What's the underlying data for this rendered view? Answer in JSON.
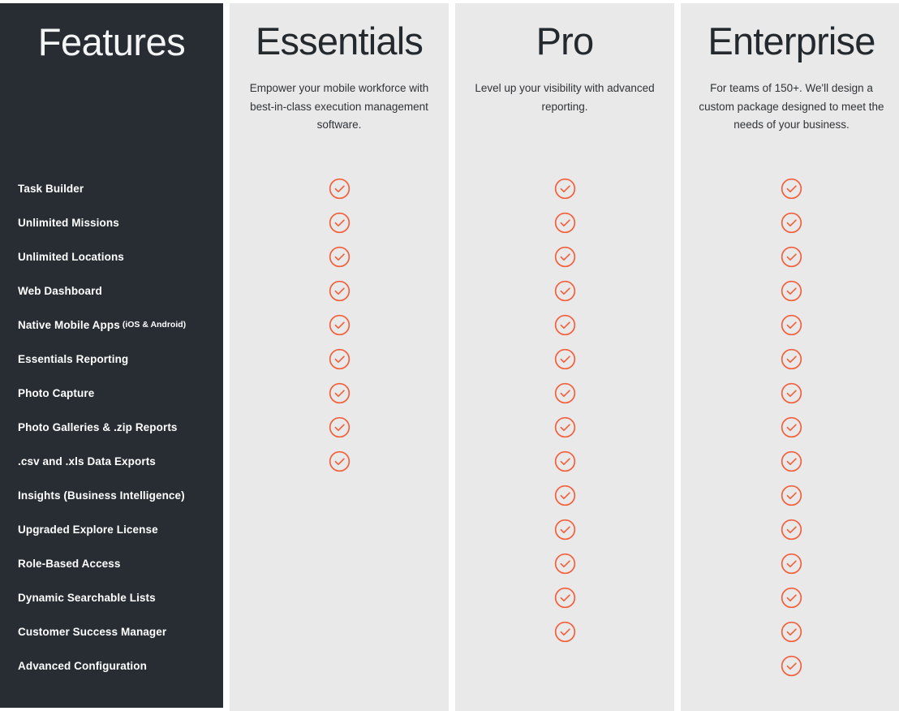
{
  "accent_color": "#f2603c",
  "sidebar_bg": "#272d33",
  "plan_bg": "#e9e9e9",
  "features": {
    "title": "Features",
    "items": [
      {
        "label": "Task Builder",
        "sub": ""
      },
      {
        "label": "Unlimited Missions",
        "sub": ""
      },
      {
        "label": "Unlimited Locations",
        "sub": ""
      },
      {
        "label": "Web Dashboard",
        "sub": ""
      },
      {
        "label": "Native Mobile Apps",
        "sub": "(iOS & Android)"
      },
      {
        "label": "Essentials Reporting",
        "sub": ""
      },
      {
        "label": "Photo Capture",
        "sub": ""
      },
      {
        "label": "Photo Galleries & .zip Reports",
        "sub": ""
      },
      {
        "label": ".csv and .xls Data Exports",
        "sub": ""
      },
      {
        "label": "Insights (Business Intelligence)",
        "sub": ""
      },
      {
        "label": "Upgraded Explore License",
        "sub": ""
      },
      {
        "label": "Role-Based Access",
        "sub": ""
      },
      {
        "label": "Dynamic Searchable Lists",
        "sub": ""
      },
      {
        "label": "Customer Success Manager",
        "sub": ""
      },
      {
        "label": "Advanced Configuration",
        "sub": ""
      }
    ]
  },
  "plans": [
    {
      "name": "Essentials",
      "description": "Empower your mobile workforce with best-in-class execution management software.",
      "included": [
        true,
        true,
        true,
        true,
        true,
        true,
        true,
        true,
        true,
        false,
        false,
        false,
        false,
        false,
        false
      ]
    },
    {
      "name": "Pro",
      "description": "Level up your visibility with advanced reporting.",
      "included": [
        true,
        true,
        true,
        true,
        true,
        true,
        true,
        true,
        true,
        true,
        true,
        true,
        true,
        true,
        false
      ]
    },
    {
      "name": "Enterprise",
      "description": "For teams of 150+. We'll design a custom package designed to meet the needs of your business.",
      "included": [
        true,
        true,
        true,
        true,
        true,
        true,
        true,
        true,
        true,
        true,
        true,
        true,
        true,
        true,
        true
      ]
    }
  ],
  "icons": {
    "check_circle": "check-circle-icon"
  }
}
